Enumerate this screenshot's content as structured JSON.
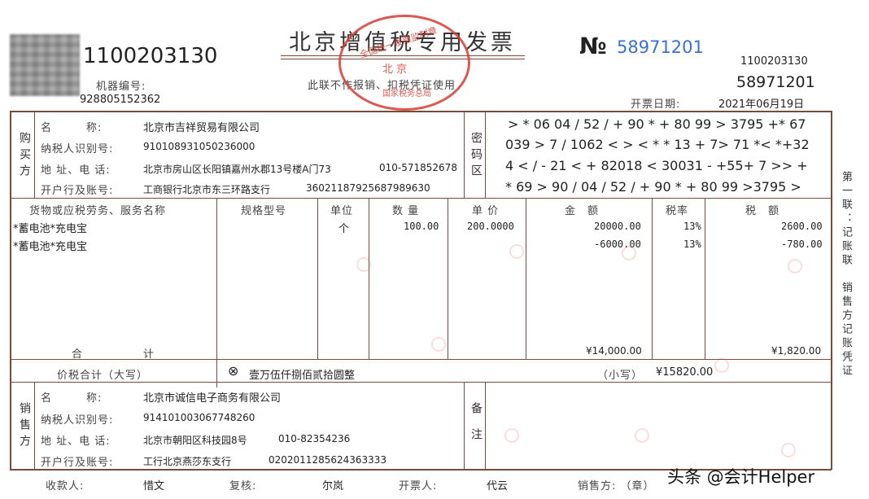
{
  "header": {
    "title": "北京增值税专用发票",
    "invoice_code": "1100203130",
    "machine_no_label": "机器编号:",
    "machine_no": "928805152362",
    "subtitle": "此联不作报销、扣税凭证使用",
    "no_symbol": "№",
    "invoice_no": "58971201",
    "right_code": "1100203130",
    "right_no": "58971201",
    "date_label": "开票日期:",
    "date": "2021年06月19日"
  },
  "seal": {
    "top": "全国统一发票监制章",
    "middle": "北 京",
    "bottom": "国家税务总局"
  },
  "buyer": {
    "side_label": "购买方",
    "name_label": "名　　　称:",
    "name": "北京市吉祥贸易有限公司",
    "tax_id_label": "纳税人识别号:",
    "tax_id": "910108931050236000",
    "addr_label": "地 址、电 话:",
    "addr": "北京市房山区长阳镇嘉州水郡13号楼A门73",
    "phone": "010-571852678",
    "bank_label": "开户行及账号:",
    "bank": "工商银行北京市东三环路支行",
    "account": "36021187925687989630"
  },
  "cipher": {
    "side_label": "密码区",
    "lines": [
      "> * 06 04 / 52 / + 90 * + 80 99 > 3795 +* 67",
      "039 > 7 / 1062 < > < * * 13 + 7> 71 *< *+32",
      "4 < / - 21 < + 82018 < 30031 - +55+ 7 >> +",
      "* 69 > 90 / 04 / 52 / + 90 * + 80 99 >3795 >"
    ]
  },
  "items": {
    "headers": {
      "name": "货物或应税劳务、服务名称",
      "spec": "规格型号",
      "unit": "单位",
      "qty": "数 量",
      "price": "单 价",
      "amount": "金　额",
      "rate": "税率",
      "tax": "税　额"
    },
    "rows": [
      {
        "name": "*蓄电池*充电宝",
        "unit": "个",
        "qty": "100.00",
        "price": "200.0000",
        "amount": "20000.00",
        "rate": "13%",
        "tax": "2600.00"
      },
      {
        "name": "*蓄电池*充电宝",
        "unit": "",
        "qty": "",
        "price": "",
        "amount": "-6000.00",
        "rate": "13%",
        "tax": "-780.00"
      }
    ],
    "total_label_1": "合",
    "total_label_2": "计",
    "total_amount": "¥14,000.00",
    "total_tax": "¥1,820.00"
  },
  "grand": {
    "label": "价税合计（大写）",
    "icon": "⊗",
    "uppercase": "壹万伍仟捌佰贰拾圆整",
    "small_label": "（小写）",
    "small": "¥15820.00"
  },
  "seller": {
    "side_label": "销售方",
    "name_label": "名　　　称:",
    "name": "北京市诚信电子商务有限公司",
    "tax_id_label": "纳税人识别号:",
    "tax_id": "914101003067748260",
    "addr_label": "地 址、电 话:",
    "addr": "北京市朝阳区科技园8号",
    "phone": "010-82354236",
    "bank_label": "开户行及账号:",
    "bank": "工行北京燕莎东支行",
    "account": "0202011285624363333",
    "remarks_label": "备注"
  },
  "footer": {
    "payee_label": "收款人:",
    "payee": "惜文",
    "review_label": "复核:",
    "review": "尔岚",
    "drawer_label": "开票人:",
    "drawer": "代云",
    "seller_label": "销售方: （章）"
  },
  "side_note": "第一联：记账联　销售方记账凭证",
  "watermark": "头条 @会计Helper",
  "colors": {
    "line": "#7a4a3a",
    "blue": "#3a6fd8",
    "seal": "#d63c32"
  }
}
